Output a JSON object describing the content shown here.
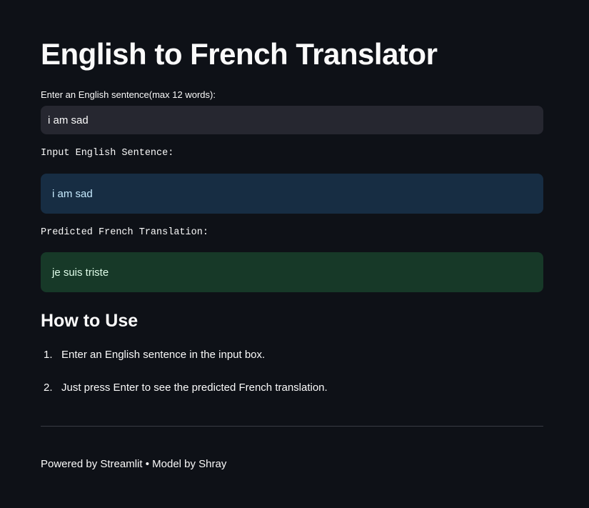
{
  "title": "English to French Translator",
  "input": {
    "label": "Enter an English sentence(max 12 words):",
    "value": "i am sad"
  },
  "input_heading": "Input English Sentence:",
  "input_echo": "i am sad",
  "output_heading": "Predicted French Translation:",
  "translation": "je suis triste",
  "how_to": {
    "title": "How to Use",
    "steps": [
      {
        "num": "1.",
        "text": "Enter an English sentence in the input box."
      },
      {
        "num": "2.",
        "text": "Just press Enter to see the predicted French translation."
      }
    ]
  },
  "footer": "Powered by Streamlit • Model by Shray"
}
